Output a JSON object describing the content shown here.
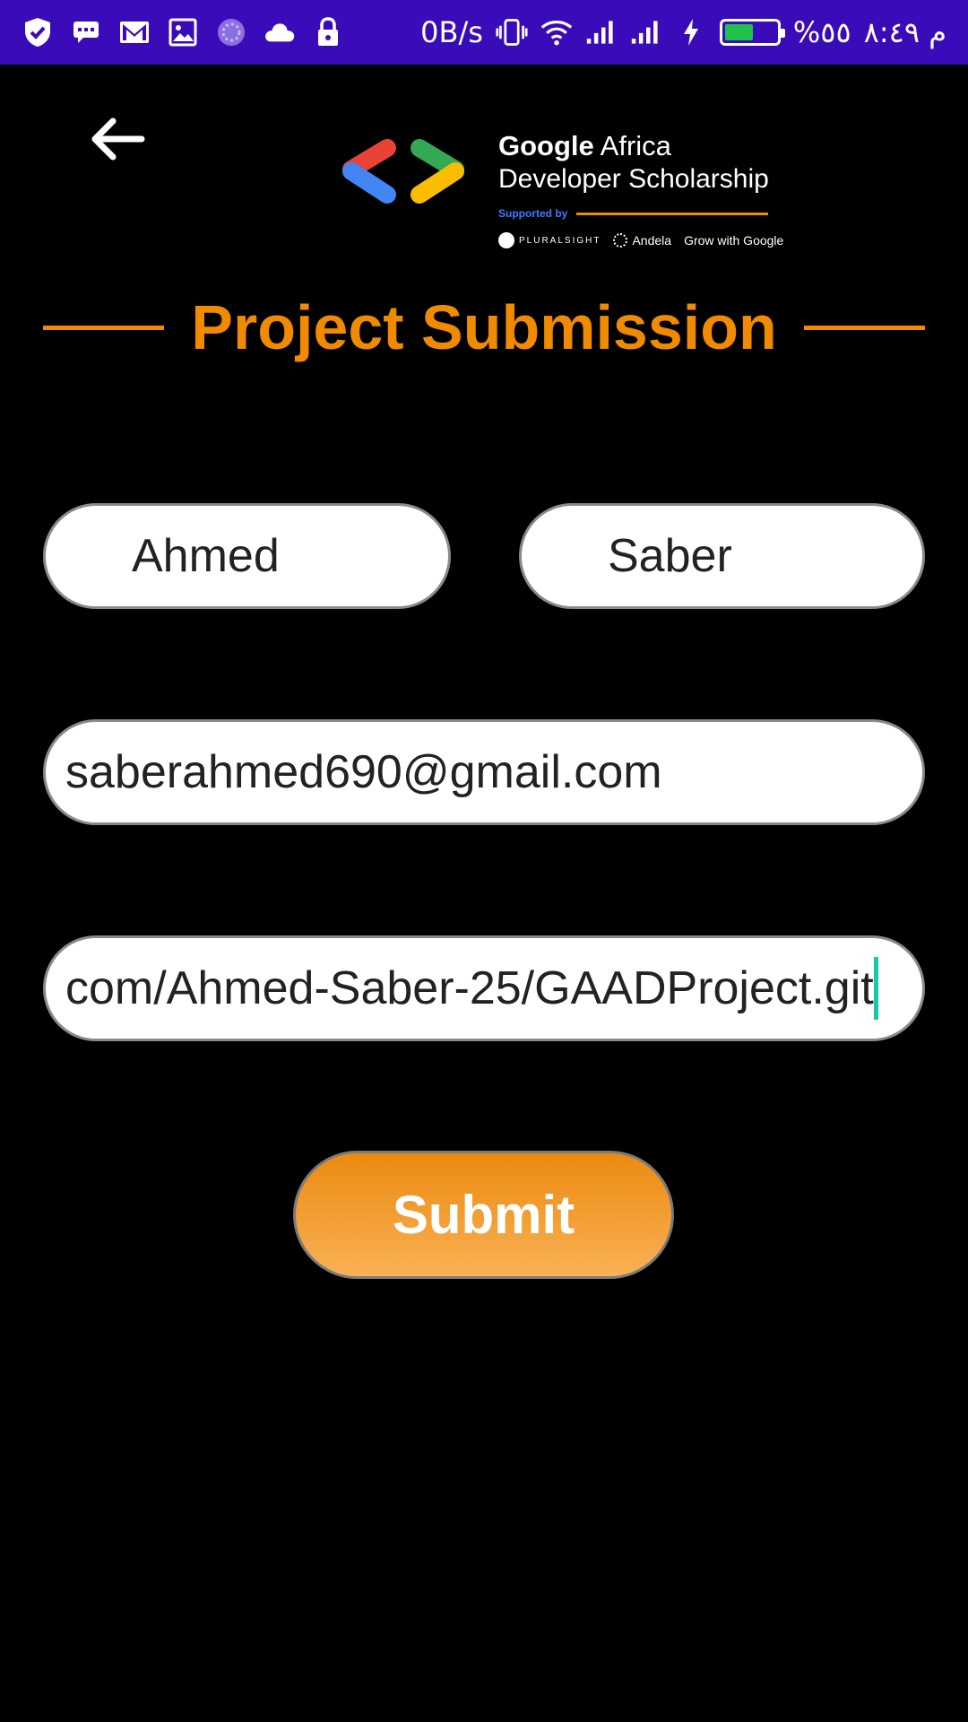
{
  "status_bar": {
    "left_icons": [
      "shield-icon",
      "message-icon",
      "gmail-icon",
      "gallery-icon",
      "loading-icon",
      "cloud-icon",
      "lock-icon"
    ],
    "net_speed": "0B/s",
    "battery_percent": "%٥٥",
    "battery_level": 0.55,
    "time": "م ٨:٤٩",
    "bar_color": "#3a0bb8"
  },
  "header": {
    "back_icon": "arrow-left-icon",
    "logo": {
      "line1_bold": "Google",
      "line1_rest": " Africa",
      "line2": "Developer Scholarship",
      "supported_by": "Supported by",
      "partners": [
        "PLURALSIGHT",
        "Andela",
        "Grow with Google"
      ]
    }
  },
  "page_title": "Project Submission",
  "form": {
    "first_name": "Ahmed",
    "last_name": "Saber",
    "email": "saberahmed690@gmail.com",
    "github_link": "com/Ahmed-Saber-25/GAADProject.git",
    "submit_label": "Submit"
  },
  "colors": {
    "accent": "#f08a00",
    "background": "#000000",
    "cursor": "#19c8a8"
  }
}
